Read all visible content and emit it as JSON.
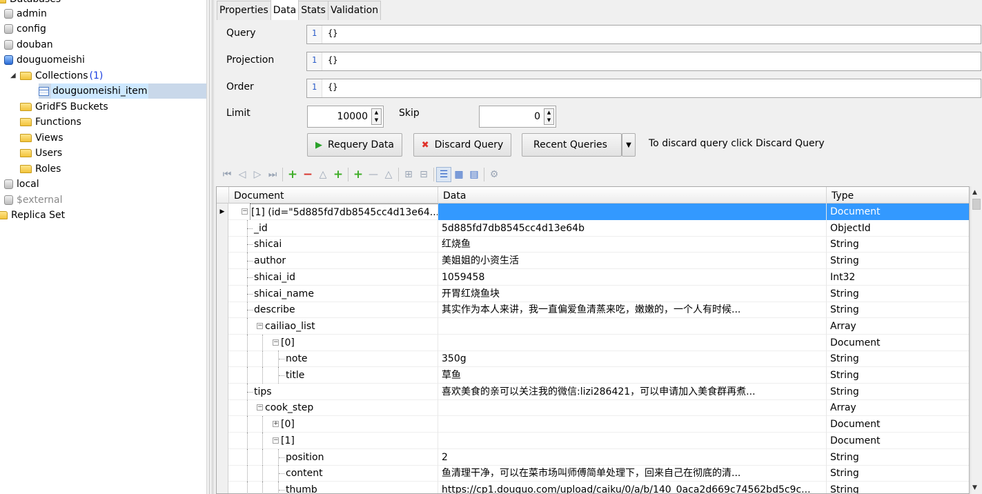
{
  "tree": {
    "root_label": "Databases",
    "items": [
      {
        "label": "admin",
        "icon": "database-icon",
        "level": 1
      },
      {
        "label": "config",
        "icon": "database-icon",
        "level": 1
      },
      {
        "label": "douban",
        "icon": "database-icon",
        "level": 1
      },
      {
        "label": "douguomeishi",
        "icon": "database-active-icon",
        "level": 1
      },
      {
        "label": "Collections",
        "count": "(1)",
        "icon": "folder-icon",
        "level": 2
      },
      {
        "label": "douguomeishi_item",
        "icon": "collection-icon",
        "level": 3,
        "selected": true
      },
      {
        "label": "GridFS Buckets",
        "icon": "folder-icon",
        "level": 2
      },
      {
        "label": "Functions",
        "icon": "folder-icon",
        "level": 2
      },
      {
        "label": "Views",
        "icon": "folder-icon",
        "level": 2
      },
      {
        "label": "Users",
        "icon": "folder-icon",
        "level": 2
      },
      {
        "label": "Roles",
        "icon": "folder-icon",
        "level": 2
      },
      {
        "label": "local",
        "icon": "database-icon",
        "level": 1
      },
      {
        "label": "$external",
        "icon": "database-icon",
        "level": 1,
        "muted": true
      },
      {
        "label": "Replica Set",
        "icon": "folder-icon",
        "level": 0
      }
    ]
  },
  "tabs": [
    "Properties",
    "Data",
    "Stats",
    "Validation"
  ],
  "active_tab": "Data",
  "query": {
    "label": "Query",
    "line": "1",
    "value": "{}"
  },
  "projection": {
    "label": "Projection",
    "line": "1",
    "value": "{}"
  },
  "order": {
    "label": "Order",
    "line": "1",
    "value": "{}"
  },
  "limit": {
    "label": "Limit",
    "value": "10000"
  },
  "skip": {
    "label": "Skip",
    "value": "0"
  },
  "buttons": {
    "requery": "Requery Data",
    "discard": "Discard Query",
    "recent": "Recent Queries"
  },
  "hint": "To discard query click Discard Query",
  "grid": {
    "columns": [
      "Document",
      "Data",
      "Type"
    ],
    "rows": [
      {
        "doc": "[1] (id=\"5d885fd7db8545cc4d13e64...",
        "data": "",
        "type": "Document",
        "level": 0,
        "expander": "minus",
        "selected": true
      },
      {
        "doc": "_id",
        "data": "5d885fd7db8545cc4d13e64b",
        "type": "ObjectId",
        "level": 1
      },
      {
        "doc": "shicai",
        "data": "红烧鱼",
        "type": "String",
        "level": 1
      },
      {
        "doc": "author",
        "data": "美姐姐的小资生活",
        "type": "String",
        "level": 1
      },
      {
        "doc": "shicai_id",
        "data": "1059458",
        "type": "Int32",
        "level": 1
      },
      {
        "doc": "shicai_name",
        "data": "开胃红烧鱼块",
        "type": "String",
        "level": 1
      },
      {
        "doc": "describe",
        "data": "其实作为本人来讲，我一直偏爱鱼清蒸来吃，嫩嫩的，一个人有时候...",
        "type": "String",
        "level": 1
      },
      {
        "doc": "cailiao_list",
        "data": "",
        "type": "Array",
        "level": 1,
        "expander": "minus"
      },
      {
        "doc": "[0]",
        "data": "",
        "type": "Document",
        "level": 2,
        "expander": "minus"
      },
      {
        "doc": "note",
        "data": "350g",
        "type": "String",
        "level": 3
      },
      {
        "doc": "title",
        "data": "草鱼",
        "type": "String",
        "level": 3
      },
      {
        "doc": "tips",
        "data": "喜欢美食的亲可以关注我的微信:lizi286421，可以申请加入美食群再煮...",
        "type": "String",
        "level": 1
      },
      {
        "doc": "cook_step",
        "data": "",
        "type": "Array",
        "level": 1,
        "expander": "minus"
      },
      {
        "doc": "[0]",
        "data": "",
        "type": "Document",
        "level": 2,
        "expander": "plus"
      },
      {
        "doc": "[1]",
        "data": "",
        "type": "Document",
        "level": 2,
        "expander": "minus"
      },
      {
        "doc": "position",
        "data": "2",
        "type": "String",
        "level": 3
      },
      {
        "doc": "content",
        "data": "鱼清理干净，可以在菜市场叫师傅简单处理下，回来自己在彻底的清...",
        "type": "String",
        "level": 3
      },
      {
        "doc": "thumb",
        "data": "https://cp1.douguo.com/upload/caiku/0/a/b/140_0aca2d669c74562bd5c9c...",
        "type": "String",
        "level": 3
      }
    ]
  }
}
